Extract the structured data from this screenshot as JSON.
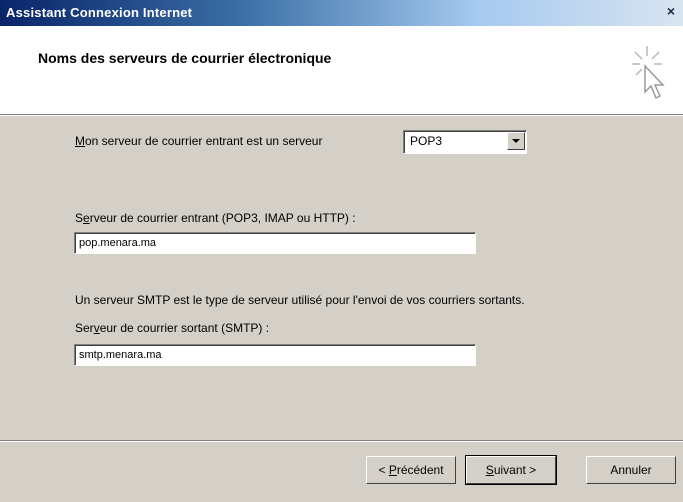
{
  "window": {
    "title": "Assistant Connexion Internet",
    "close_glyph": "×"
  },
  "header": {
    "title": "Noms des serveurs de courrier électronique",
    "icon": "wizard-cursor-icon"
  },
  "incoming_type": {
    "label_first": "M",
    "label_rest": "on serveur de courrier entrant est un serveur",
    "selected": "POP3"
  },
  "incoming_server": {
    "label_first": "S",
    "label_u": "e",
    "label_rest": "rveur de courrier entrant (POP3, IMAP ou HTTP) :",
    "value": "pop.menara.ma"
  },
  "smtp_info": "Un serveur SMTP est le type de serveur utilisé pour l'envoi de vos courriers sortants.",
  "outgoing_server": {
    "label_first": "Ser",
    "label_u": "v",
    "label_rest": "eur de courrier sortant (SMTP) :",
    "value": "smtp.menara.ma"
  },
  "buttons": {
    "back_prefix": "< ",
    "back_u": "P",
    "back_rest": "récédent",
    "next_u": "S",
    "next_rest": "uivant >",
    "cancel": "Annuler"
  }
}
